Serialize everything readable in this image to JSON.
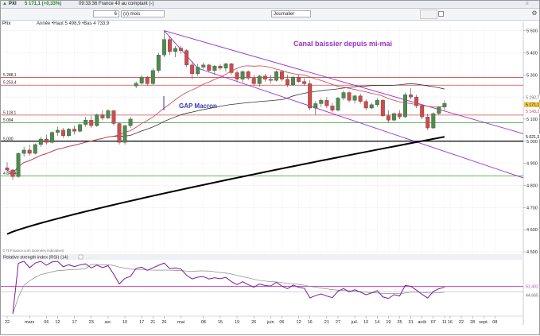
{
  "header": {
    "ticker": "PXI",
    "price_change": "5 171,1 (+0,33%)",
    "time_desc": "09:33:36 France 40 au comptant (-)"
  },
  "toolbar": {
    "period_value": "6",
    "period_unit": "(x) mois",
    "interval": "Journalier",
    "chart_label": "Prix",
    "year_stats": "Année •Haut 5 498,9 •Bas 4 733,9"
  },
  "colors": {
    "bull": "#4c8c4c",
    "bear": "#d24a4a",
    "channel": "#9b30c8",
    "ma_long": "#000000",
    "ma_mid": "#333333",
    "ma_short": "#d03c50",
    "rsi": "#7a1aa0",
    "rsi_ma": "#888888"
  },
  "chart_data": {
    "type": "candlestick",
    "ylim": [
      4500,
      5520
    ],
    "yticks": [
      {
        "v": 5500,
        "label": "5 500"
      },
      {
        "v": 5400,
        "label": "5 400"
      },
      {
        "v": 5300,
        "label": "5 300"
      },
      {
        "v": 5200,
        "label": "5 200"
      },
      {
        "v": 5100,
        "label": "5 100"
      },
      {
        "v": 5000,
        "label": "5 000"
      },
      {
        "v": 4900,
        "label": "4 900"
      },
      {
        "v": 4800,
        "label": "4 800"
      },
      {
        "v": 4700,
        "label": "4 700"
      },
      {
        "v": 4600,
        "label": "4 600"
      },
      {
        "v": 4500,
        "label": "4 500"
      }
    ],
    "price_tags": [
      {
        "v": 5192.7,
        "label": "5 192,7",
        "color": "#555555"
      },
      {
        "v": 5171.1,
        "label": "5 171,1",
        "color": "#e0b020"
      },
      {
        "v": 5143.2,
        "label": "5 143,2",
        "color": "#d03c50"
      },
      {
        "v": 5021.3,
        "label": "5 021,3",
        "color": "#000000"
      }
    ],
    "hlines": [
      {
        "v": 5288.1,
        "label": "5 288,1",
        "color": "#d24a4a"
      },
      {
        "v": 5253.4,
        "label": "5 253,4",
        "color": "#d24a4a"
      },
      {
        "v": 5118.1,
        "label": "5 118,1",
        "color": "#d24a4a"
      },
      {
        "v": 5084,
        "label": "5 084",
        "color": "#3a9a3a"
      },
      {
        "v": 5000,
        "label": "5 000",
        "color": "#000000"
      },
      {
        "v": 4843.4,
        "label": "4 843,4",
        "color": "#3a9a3a"
      }
    ],
    "ohlc": [
      [
        4880,
        4905,
        4860,
        4870
      ],
      [
        4870,
        4875,
        4825,
        4840
      ],
      [
        4840,
        4950,
        4835,
        4945
      ],
      [
        4945,
        4975,
        4930,
        4960
      ],
      [
        4960,
        4985,
        4935,
        4945
      ],
      [
        4945,
        4990,
        4940,
        4985
      ],
      [
        4985,
        5020,
        4975,
        5010
      ],
      [
        5010,
        5030,
        4985,
        4995
      ],
      [
        4995,
        5045,
        4990,
        5040
      ],
      [
        5040,
        5065,
        5025,
        5050
      ],
      [
        5050,
        5060,
        5015,
        5025
      ],
      [
        5025,
        5060,
        5020,
        5055
      ],
      [
        5055,
        5070,
        5030,
        5045
      ],
      [
        5045,
        5080,
        5040,
        5075
      ],
      [
        5075,
        5110,
        5065,
        5095
      ],
      [
        5095,
        5115,
        5060,
        5070
      ],
      [
        5070,
        5125,
        5065,
        5120
      ],
      [
        5120,
        5140,
        5095,
        5105
      ],
      [
        5105,
        5145,
        5100,
        5138
      ],
      [
        5138,
        5140,
        5070,
        5080
      ],
      [
        5080,
        5085,
        4985,
        4995
      ],
      [
        4995,
        5075,
        4985,
        5070
      ],
      [
        5070,
        5110,
        5060,
        5100
      ],
      [
        5250,
        5270,
        5240,
        5262
      ],
      [
        5262,
        5300,
        5255,
        5290
      ],
      [
        5290,
        5295,
        5250,
        5260
      ],
      [
        5260,
        5330,
        5255,
        5320
      ],
      [
        5320,
        5400,
        5310,
        5390
      ],
      [
        5390,
        5500,
        5380,
        5460
      ],
      [
        5460,
        5475,
        5390,
        5405
      ],
      [
        5405,
        5430,
        5380,
        5420
      ],
      [
        5420,
        5430,
        5395,
        5410
      ],
      [
        5410,
        5415,
        5335,
        5345
      ],
      [
        5345,
        5360,
        5280,
        5305
      ],
      [
        5305,
        5350,
        5295,
        5335
      ],
      [
        5335,
        5355,
        5325,
        5345
      ],
      [
        5345,
        5350,
        5310,
        5320
      ],
      [
        5320,
        5345,
        5300,
        5340
      ],
      [
        5340,
        5350,
        5320,
        5330
      ],
      [
        5330,
        5355,
        5315,
        5350
      ],
      [
        5350,
        5355,
        5300,
        5310
      ],
      [
        5310,
        5320,
        5270,
        5280
      ],
      [
        5280,
        5320,
        5265,
        5315
      ],
      [
        5315,
        5320,
        5275,
        5285
      ],
      [
        5285,
        5300,
        5250,
        5260
      ],
      [
        5260,
        5300,
        5245,
        5295
      ],
      [
        5295,
        5305,
        5270,
        5280
      ],
      [
        5280,
        5300,
        5260,
        5275
      ],
      [
        5275,
        5320,
        5270,
        5315
      ],
      [
        5315,
        5320,
        5270,
        5280
      ],
      [
        5280,
        5300,
        5245,
        5255
      ],
      [
        5255,
        5295,
        5250,
        5290
      ],
      [
        5290,
        5300,
        5265,
        5270
      ],
      [
        5270,
        5285,
        5250,
        5260
      ],
      [
        5260,
        5275,
        5140,
        5150
      ],
      [
        5150,
        5180,
        5120,
        5170
      ],
      [
        5170,
        5195,
        5155,
        5185
      ],
      [
        5185,
        5200,
        5150,
        5160
      ],
      [
        5160,
        5175,
        5130,
        5140
      ],
      [
        5140,
        5200,
        5135,
        5195
      ],
      [
        5195,
        5230,
        5185,
        5220
      ],
      [
        5220,
        5225,
        5175,
        5185
      ],
      [
        5185,
        5210,
        5170,
        5205
      ],
      [
        5205,
        5215,
        5170,
        5180
      ],
      [
        5180,
        5190,
        5140,
        5150
      ],
      [
        5150,
        5175,
        5145,
        5165
      ],
      [
        5165,
        5195,
        5155,
        5185
      ],
      [
        5185,
        5190,
        5110,
        5115
      ],
      [
        5115,
        5140,
        5085,
        5095
      ],
      [
        5095,
        5130,
        5090,
        5125
      ],
      [
        5125,
        5140,
        5100,
        5110
      ],
      [
        5110,
        5220,
        5105,
        5210
      ],
      [
        5210,
        5240,
        5190,
        5200
      ],
      [
        5200,
        5210,
        5150,
        5160
      ],
      [
        5160,
        5165,
        5100,
        5110
      ],
      [
        5110,
        5125,
        5050,
        5060
      ],
      [
        5060,
        5130,
        5055,
        5125
      ],
      [
        5125,
        5160,
        5120,
        5155
      ],
      [
        5155,
        5185,
        5140,
        5171.1
      ]
    ],
    "channel": {
      "upper": [
        [
          28,
          5500
        ],
        [
          83,
          5100
        ]
      ],
      "lower": [
        [
          34,
          5330
        ],
        [
          82,
          4920
        ]
      ],
      "label": "Canal baissier depuis mi-mai"
    },
    "gap_label": "GAP Macron",
    "x_ticks": [
      {
        "i": 0,
        "label": "22"
      },
      {
        "i": 4,
        "label": "mars"
      },
      {
        "i": 7,
        "label": "06"
      },
      {
        "i": 9,
        "label": "12"
      },
      {
        "i": 12,
        "label": "17"
      },
      {
        "i": 15,
        "label": "23"
      },
      {
        "i": 18,
        "label": "avr."
      },
      {
        "i": 21,
        "label": "10"
      },
      {
        "i": 24,
        "label": "17"
      },
      {
        "i": 26,
        "label": "21"
      },
      {
        "i": 28,
        "label": "26"
      },
      {
        "i": 31,
        "label": "mai"
      },
      {
        "i": 35,
        "label": "08"
      },
      {
        "i": 38,
        "label": "15"
      },
      {
        "i": 41,
        "label": "19"
      },
      {
        "i": 44,
        "label": "26"
      },
      {
        "i": 47,
        "label": "juin"
      },
      {
        "i": 49,
        "label": "06"
      },
      {
        "i": 52,
        "label": "12"
      },
      {
        "i": 54,
        "label": "16"
      },
      {
        "i": 57,
        "label": "21"
      },
      {
        "i": 59,
        "label": "27"
      },
      {
        "i": 62,
        "label": "juil."
      },
      {
        "i": 64,
        "label": "10"
      },
      {
        "i": 66,
        "label": "14"
      },
      {
        "i": 68,
        "label": "19"
      },
      {
        "i": 70,
        "label": "25"
      },
      {
        "i": 72,
        "label": "31"
      },
      {
        "i": 74,
        "label": "août"
      },
      {
        "i": 76,
        "label": "07"
      },
      {
        "i": 78,
        "label": "11"
      },
      {
        "i": 79,
        "label": "16"
      },
      {
        "i": 81,
        "label": "22"
      },
      {
        "i": 83,
        "label": "28"
      },
      {
        "i": 85,
        "label": "sept."
      },
      {
        "i": 87,
        "label": "08"
      }
    ],
    "source": "© IT-Finance.com Données indicatives",
    "rsi": {
      "label": "Relative strength index (RSI) (14)",
      "tags": [
        "51,402",
        "44,665"
      ],
      "ylim": [
        20,
        80
      ],
      "levels": [
        45,
        51.402
      ]
    }
  }
}
